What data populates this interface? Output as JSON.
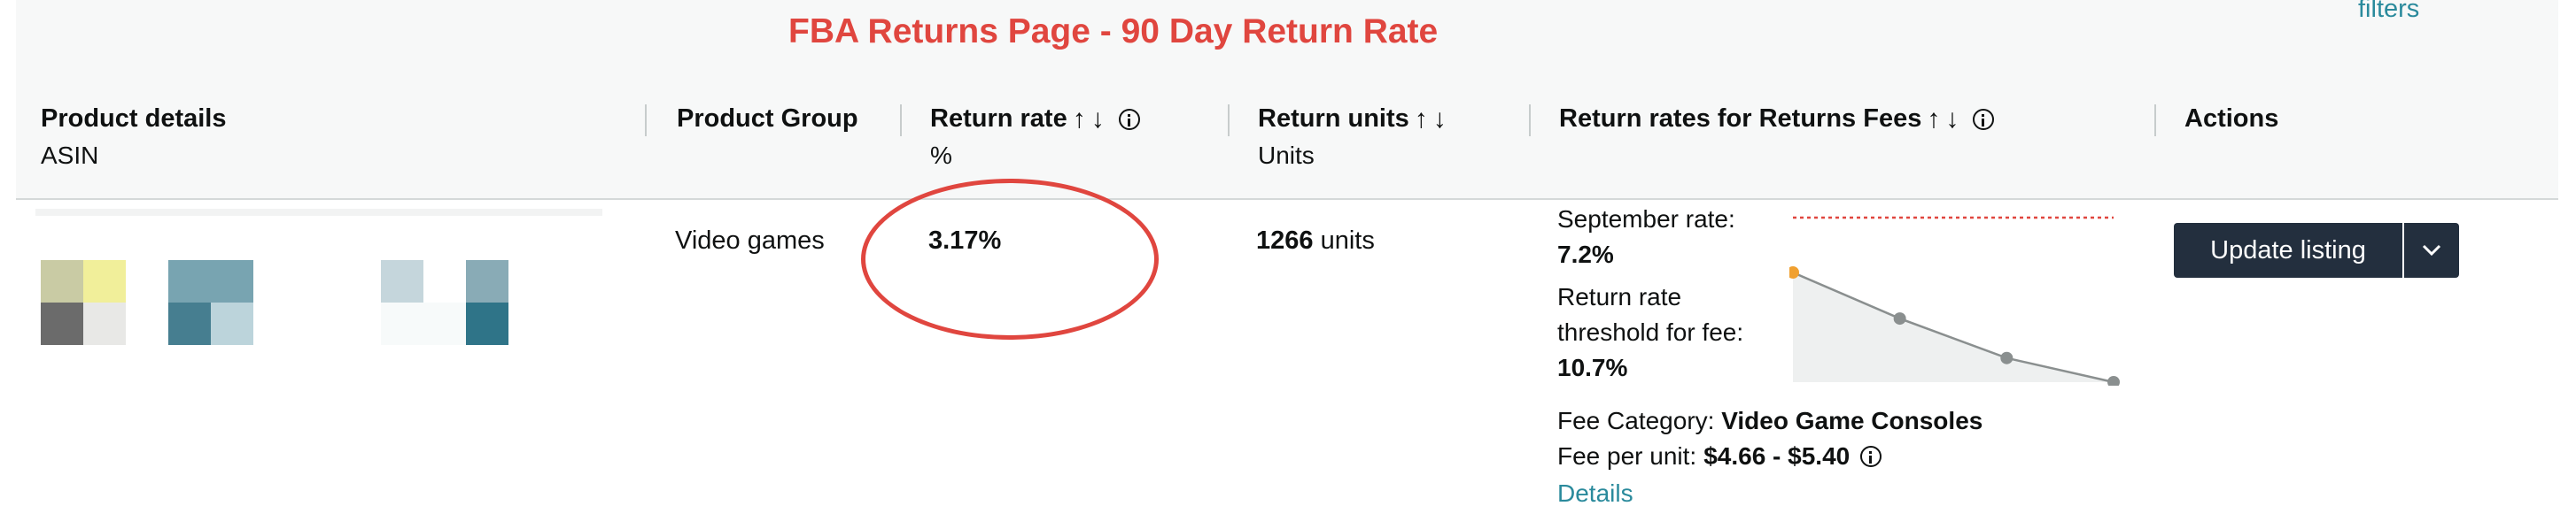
{
  "annotation": {
    "title": "FBA Returns Page - 90 Day Return Rate",
    "color": "#e0463f"
  },
  "top_link": "filters",
  "columns": [
    {
      "label": "Product details",
      "sub": "ASIN"
    },
    {
      "label": "Product Group",
      "sub": ""
    },
    {
      "label": "Return rate",
      "sub": "%"
    },
    {
      "label": "Return units",
      "sub": "Units"
    },
    {
      "label": "Return rates for Returns Fees",
      "sub": ""
    },
    {
      "label": "Actions",
      "sub": ""
    }
  ],
  "sort_icons": {
    "up": "↑",
    "down": "↓"
  },
  "row": {
    "product_group": "Video games",
    "return_rate": "3.17%",
    "return_units_value": "1266",
    "return_units_suffix": "units",
    "september_rate_label": "September rate:",
    "september_rate_value": "7.2%",
    "threshold_label_line1": "Return rate",
    "threshold_label_line2": "threshold for fee:",
    "threshold_value": "10.7%",
    "fee_category_label": "Fee Category:",
    "fee_category_value": "Video Game Consoles",
    "fee_per_unit_label": "Fee per unit:",
    "fee_per_unit_value": "$4.66 - $5.40",
    "details_link": "Details"
  },
  "actions": {
    "primary_button": "Update listing",
    "dropdown_icon": "chevron-down-icon"
  },
  "sparkline": {
    "threshold_line_color": "#e0463f",
    "points": [
      1.0,
      0.58,
      0.22,
      0.0
    ],
    "first_point_color": "#f0a030",
    "point_color": "#8a8f8f"
  },
  "colors": {
    "accent_link": "#2a8a9c",
    "button_bg": "#232f3e"
  }
}
